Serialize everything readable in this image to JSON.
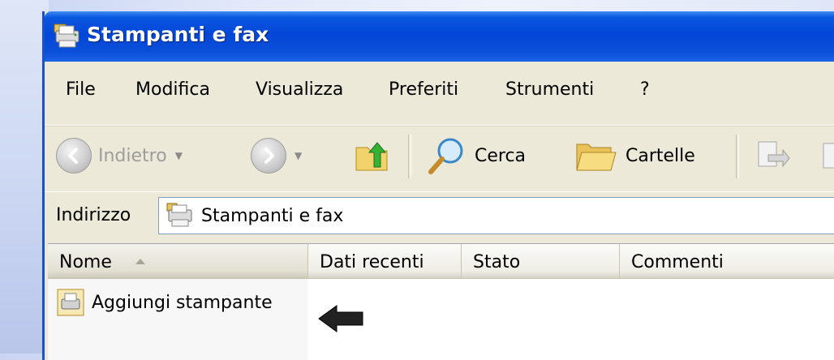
{
  "window": {
    "title": "Stampanti e fax"
  },
  "menubar": {
    "items": [
      "File",
      "Modifica",
      "Visualizza",
      "Preferiti",
      "Strumenti",
      "?"
    ]
  },
  "toolbar": {
    "back_label": "Indietro",
    "search_label": "Cerca",
    "folders_label": "Cartelle"
  },
  "addressbar": {
    "label": "Indirizzo",
    "value": "Stampanti e fax"
  },
  "listview": {
    "columns": [
      "Nome",
      "Dati recenti",
      "Stato",
      "Commenti"
    ],
    "sorted_column": "Nome",
    "items": [
      {
        "label": "Aggiungi stampante",
        "icon": "add-printer-icon"
      }
    ]
  },
  "annotations": {
    "pointer": "black-arrow-left-icon"
  },
  "colors": {
    "titlebar": "#0446d8",
    "chrome": "#ece9d8",
    "list_bg": "#ffffff"
  }
}
